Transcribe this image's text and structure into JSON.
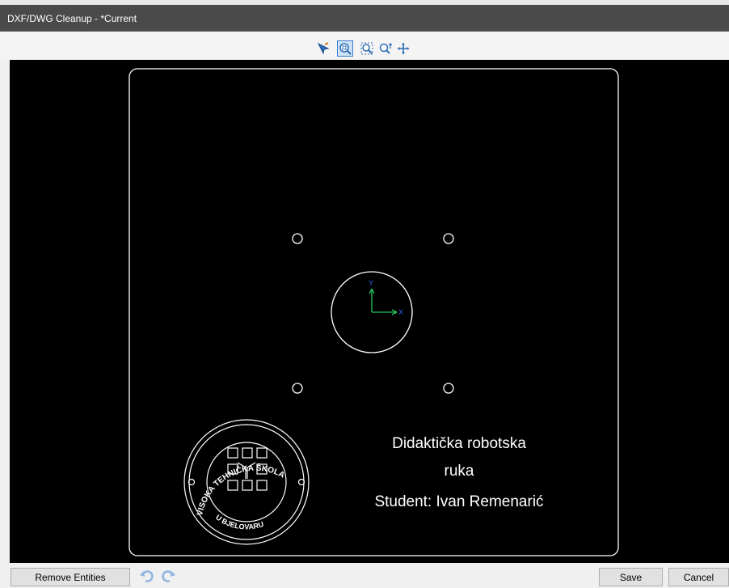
{
  "window": {
    "title": "DXF/DWG Cleanup - *Current"
  },
  "toolbar": {
    "tools": [
      {
        "name": "select-tool-icon",
        "active": false
      },
      {
        "name": "zoom-fit-icon",
        "active": true
      },
      {
        "name": "zoom-area-icon",
        "active": false
      },
      {
        "name": "zoom-in-out-icon",
        "active": false
      },
      {
        "name": "pan-icon",
        "active": false
      }
    ]
  },
  "drawing": {
    "background": "#000000",
    "line_color": "#ffffff",
    "axis_y_label": "Y",
    "axis_x_label": "X",
    "axis_y_color": "#22c55e",
    "axis_x_color": "#2563eb",
    "text_line1": "Didaktička robotska",
    "text_line2": "ruka",
    "text_line3": "Student: Ivan Remenarić",
    "logo_top_text": "VISOKA TEHNIČKA ŠKOLA",
    "logo_bottom_text": "U BJELOVARU"
  },
  "footer": {
    "remove_entities_label": "Remove Entities",
    "save_label": "Save",
    "cancel_label": "Cancel",
    "undo_icon": "undo-icon",
    "redo_icon": "redo-icon"
  }
}
